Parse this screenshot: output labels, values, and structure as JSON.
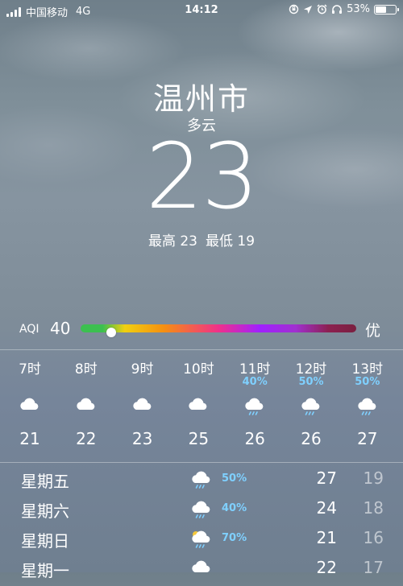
{
  "status_bar": {
    "carrier": "中国移动",
    "network": "4G",
    "time": "14:12",
    "battery": "53%",
    "battery_level": 0.53
  },
  "current": {
    "city": "温州市",
    "condition": "多云",
    "temperature": "23",
    "high": "最高 23",
    "low": "最低 19"
  },
  "aqi": {
    "label": "AQI",
    "value": "40",
    "grade": "优",
    "level_fraction": 0.11
  },
  "hourly": [
    {
      "time": "7时",
      "precip": "",
      "icon": "cloud-icon",
      "temp": "21"
    },
    {
      "time": "8时",
      "precip": "",
      "icon": "cloud-icon",
      "temp": "22"
    },
    {
      "time": "9时",
      "precip": "",
      "icon": "cloud-icon",
      "temp": "23"
    },
    {
      "time": "10时",
      "precip": "",
      "icon": "cloud-icon",
      "temp": "25"
    },
    {
      "time": "11时",
      "precip": "40%",
      "icon": "rain-cloud-icon",
      "temp": "26"
    },
    {
      "time": "12时",
      "precip": "50%",
      "icon": "rain-cloud-icon",
      "temp": "26"
    },
    {
      "time": "13时",
      "precip": "50%",
      "icon": "rain-cloud-icon",
      "temp": "27"
    }
  ],
  "daily": [
    {
      "day": "星期五",
      "icon": "rain-cloud-icon",
      "precip": "50%",
      "high": "27",
      "low": "19"
    },
    {
      "day": "星期六",
      "icon": "rain-cloud-icon",
      "precip": "40%",
      "high": "24",
      "low": "18"
    },
    {
      "day": "星期日",
      "icon": "rain-sun-cloud-icon",
      "precip": "70%",
      "high": "21",
      "low": "16"
    },
    {
      "day": "星期一",
      "icon": "cloud-icon",
      "precip": "",
      "high": "22",
      "low": "17"
    }
  ],
  "colors": {
    "precip_accent": "#7fd0ff",
    "aqi_good": "#3cc050"
  }
}
